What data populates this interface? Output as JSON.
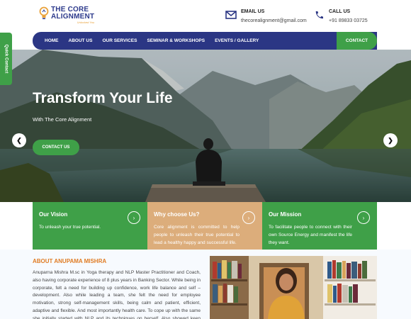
{
  "header": {
    "logo_line1": "THE CORE",
    "logo_line2": "ALIGNMENT",
    "logo_tagline": "Unlocked You",
    "email_label": "EMAIL US",
    "email_value": "thecorealignment@gmail.com",
    "call_label": "CALL US",
    "call_value": "+91 89833 03725"
  },
  "nav": {
    "items": [
      "HOME",
      "ABOUT US",
      "OUR SERVICES",
      "SEMINAR & WORKSHOPS",
      "EVENTS / GALLERY"
    ],
    "contact": "CONTACT"
  },
  "quick_contact": "Quick Contact",
  "hero": {
    "title": "Transform Your Life",
    "subtitle": "With The Core Alignment",
    "button": "CONTACT US",
    "prev_arrow": "❮",
    "next_arrow": "❯"
  },
  "features": [
    {
      "title": "Our Vision",
      "text": "To unleash your true potential."
    },
    {
      "title": "Why choose Us?",
      "text": "Core alignment is committed to help people to unleash their true potential to lead a healthy happy and successful life."
    },
    {
      "title": "Our Mission",
      "text": "To facilitate people to connect with their own Source Energy and manifest the life they want."
    }
  ],
  "about": {
    "title": "ABOUT ANUPAMA MISHRA",
    "text": "Anuparna Mishra M.sc in Yoga therapy and NLP Master Practitioner and Coach, also having corporate experience of 8 plus years in Banking Sector. While being in corporate, felt a need for building up confidence, work life balance and self – development. Also while leading a team, she felt the need for employee motivation, strong self-management skills, being calm and patient, efficient, adaptive and flexible. And most importantly health care. To cope up with the same she initially started with NLP and its techniques on herself. Also showed keen interest in one of"
  },
  "colors": {
    "nav_blue": "#2b3684",
    "green": "#3fa048",
    "tan": "#dcad7b",
    "orange": "#e07c24"
  }
}
